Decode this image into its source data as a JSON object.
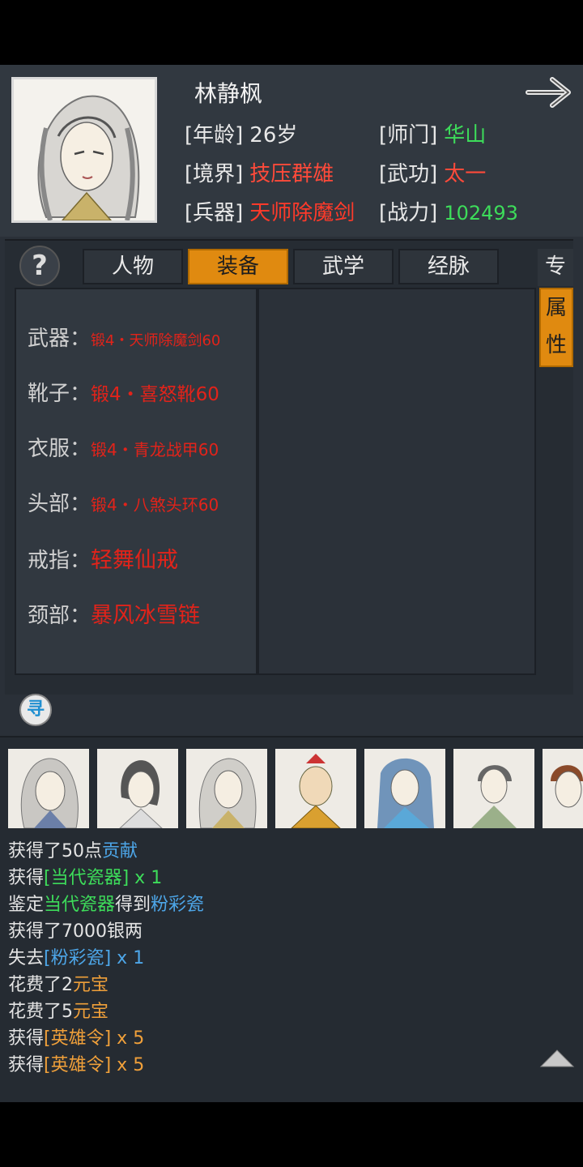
{
  "character": {
    "name": "林静枫",
    "age_label": "[年龄]",
    "age": "26岁",
    "school_label": "[师门]",
    "school": "华山",
    "realm_label": "[境界]",
    "realm": "技压群雄",
    "martial_label": "[武功]",
    "martial": "太一",
    "weapon_label": "[兵器]",
    "weapon": "天师除魔剑",
    "power_label": "[战力]",
    "power": "102493"
  },
  "tabs": [
    "人物",
    "装备",
    "武学",
    "经脉"
  ],
  "active_tab": "装备",
  "side_tabs": {
    "top": "专",
    "active_1": "属",
    "active_2": "性"
  },
  "help_icon": "?",
  "swap_icon": "寻",
  "equipment": [
    {
      "slot": "武器：",
      "item": "锻4・天师除魔剑60"
    },
    {
      "slot": "靴子：",
      "item": "锻4・喜怒靴60"
    },
    {
      "slot": "衣服：",
      "item": "锻4・青龙战甲60"
    },
    {
      "slot": "头部：",
      "item": "锻4・八煞头环60"
    },
    {
      "slot": "戒指：",
      "item": "轻舞仙戒"
    },
    {
      "slot": "颈部：",
      "item": "暴风冰雪链"
    }
  ],
  "log": {
    "l1": {
      "a": "获得了50点",
      "b": "贡献"
    },
    "l2": {
      "a": "获得",
      "b": "[当代瓷器]",
      "c": " x 1"
    },
    "l3": {
      "a": "鉴定",
      "b": "当代瓷器",
      "c": "得到",
      "d": "粉彩瓷"
    },
    "l4": {
      "a": "获得了7000银两"
    },
    "l5": {
      "a": "失去",
      "b": "[粉彩瓷]",
      "c": " x 1"
    },
    "l6": {
      "a": "花费了2",
      "b": "元宝"
    },
    "l7": {
      "a": "花费了5",
      "b": "元宝"
    },
    "l8": {
      "a": "获得",
      "b": "[英雄令]",
      "c": " x 5"
    },
    "l9": {
      "a": "获得",
      "b": "[英雄令]",
      "c": " x 5"
    }
  },
  "colors": {
    "accent": "#e08a10",
    "item_red": "#e2231a",
    "value_green": "#3ddc5a",
    "link_blue": "#4da6e8",
    "orange": "#f0a03a"
  }
}
